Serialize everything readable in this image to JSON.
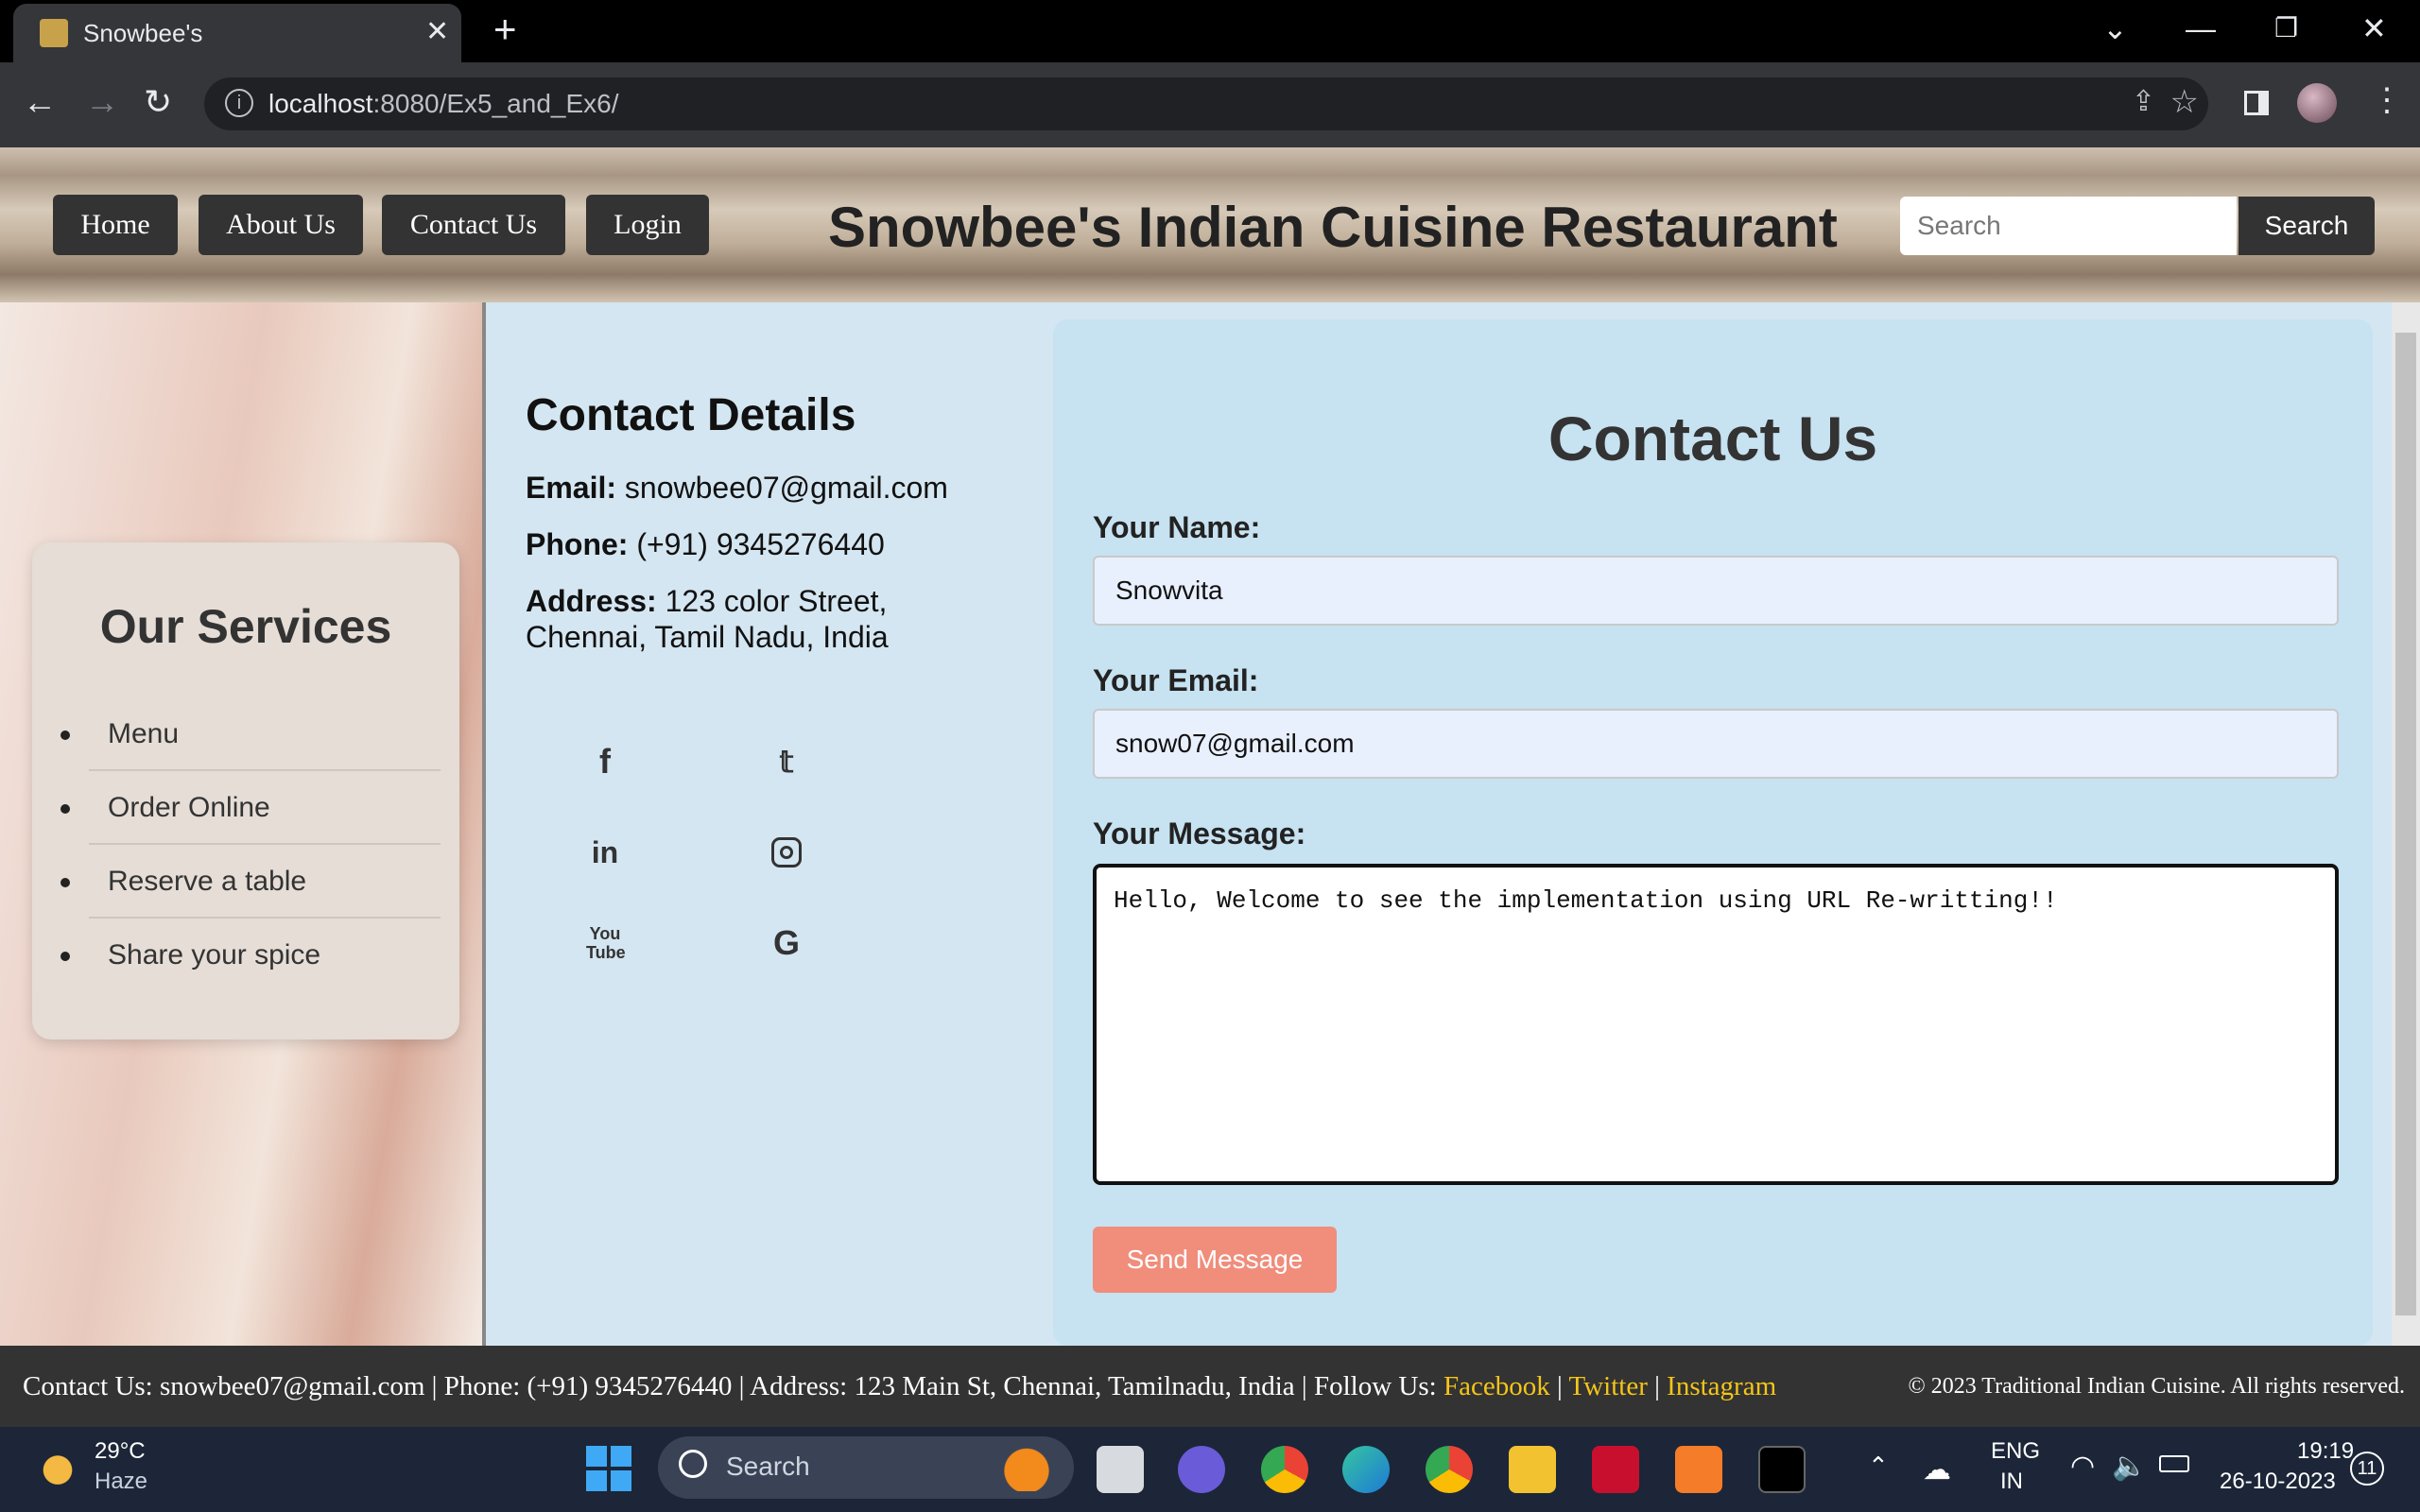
{
  "browser": {
    "tab_title": "Snowbee's",
    "close_tab": "✕",
    "new_tab": "+",
    "url_host": "localhost",
    "url_rest": ":8080/Ex5_and_Ex6/"
  },
  "nav": {
    "home": "Home",
    "about": "About Us",
    "contact": "Contact Us",
    "login": "Login"
  },
  "site_title": "Snowbee's Indian Cuisine Restaurant",
  "search": {
    "placeholder": "Search",
    "button": "Search"
  },
  "services": {
    "title": "Our Services",
    "items": [
      "Menu",
      "Order Online",
      "Reserve a table",
      "Share your spice"
    ]
  },
  "contact_details": {
    "title": "Contact Details",
    "email_label": "Email:",
    "email": "snowbee07@gmail.com",
    "phone_label": "Phone:",
    "phone": "(+91) 9345276440",
    "address_label": "Address:",
    "address_line1": "123 color Street,",
    "address_line2": "Chennai, Tamil Nadu, India"
  },
  "social_icons": [
    "facebook-icon",
    "twitter-icon",
    "linkedin-icon",
    "instagram-icon",
    "youtube-icon",
    "google-icon"
  ],
  "form": {
    "title": "Contact Us",
    "name_label": "Your Name:",
    "name_value": "Snowvita",
    "email_label": "Your Email:",
    "email_value": "snow07@gmail.com",
    "message_label": "Your Message:",
    "message_value": "Hello, Welcome to see the implementation using URL Re-writting!!",
    "submit": "Send Message"
  },
  "footer": {
    "text": "Contact Us: snowbee07@gmail.com | Phone: (+91) 9345276440 | Address: 123 Main St, Chennai, Tamilnadu, India | Follow Us:",
    "facebook": "Facebook",
    "twitter": "Twitter",
    "instagram": "Instagram",
    "sep": "|",
    "copyright": "© 2023 Traditional Indian Cuisine. All rights reserved."
  },
  "taskbar": {
    "temperature": "29°C",
    "weather": "Haze",
    "search": "Search",
    "lang1": "ENG",
    "lang2": "IN",
    "time": "19:19",
    "date": "26-10-2023",
    "notifications": "11"
  },
  "colors": {
    "send_button": "#f08d7b",
    "footer_link": "#f5c518",
    "page_bg": "#d4e6f1"
  }
}
